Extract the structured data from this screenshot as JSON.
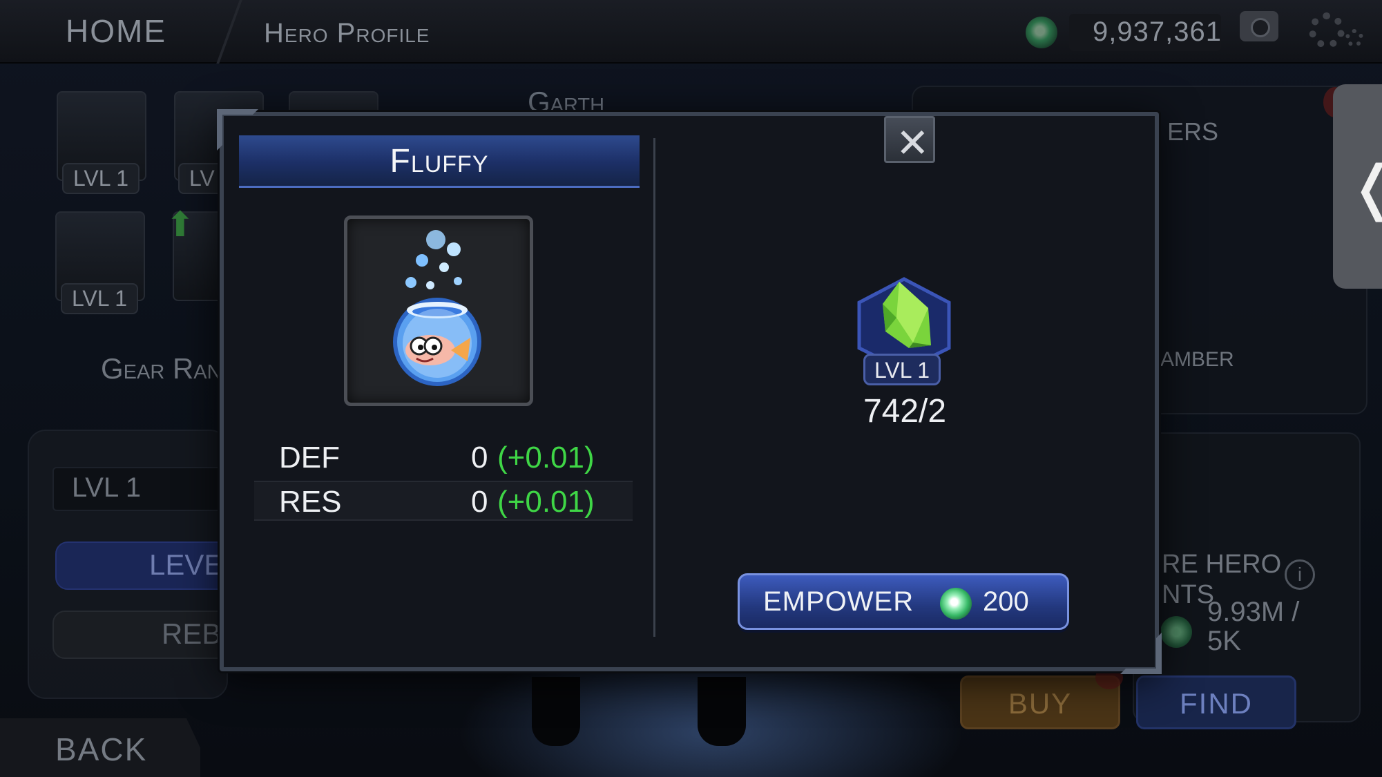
{
  "topbar": {
    "home_label": "HOME",
    "page_label": "Hero Profile",
    "balance": "9,937,361"
  },
  "background": {
    "hero_name": "Garth",
    "gear_slots": [
      {
        "level": "LVL 1"
      },
      {
        "level": "LV"
      },
      {
        "level": "LVL 1"
      }
    ],
    "gear_rank_label": "Gear Ran",
    "level_field": "LVL 1",
    "level_button": "LEVE",
    "rebirth_button": "REBI",
    "right_header_fragment": "ERS",
    "chamber_fragment": "AMBER",
    "hero_points_label_1": "RE HERO",
    "hero_points_label_2": "NTS",
    "hero_points_value_1": "9.93M /",
    "hero_points_value_2": "5K",
    "buy_button": "BUY",
    "find_button": "FIND",
    "back_button": "BACK",
    "side_tab_glyph": "❬"
  },
  "modal": {
    "title": "Fluffy",
    "close_glyph": "✕",
    "item_icon": "fishbowl-icon",
    "stats": [
      {
        "label": "DEF",
        "base": "0",
        "bonus": "(+0.01)"
      },
      {
        "label": "RES",
        "base": "0",
        "bonus": "(+0.01)"
      }
    ],
    "catalyst": {
      "level": "LVL 1",
      "progress": "742/2",
      "icon": "green-crystal-icon"
    },
    "empower": {
      "label": "EMPOWER",
      "cost": "200",
      "currency_icon": "green-gem-currency-icon"
    }
  },
  "colors": {
    "bonus_green": "#3fd646",
    "button_blue": "#2c47a0",
    "title_blue": "#233a7a"
  }
}
